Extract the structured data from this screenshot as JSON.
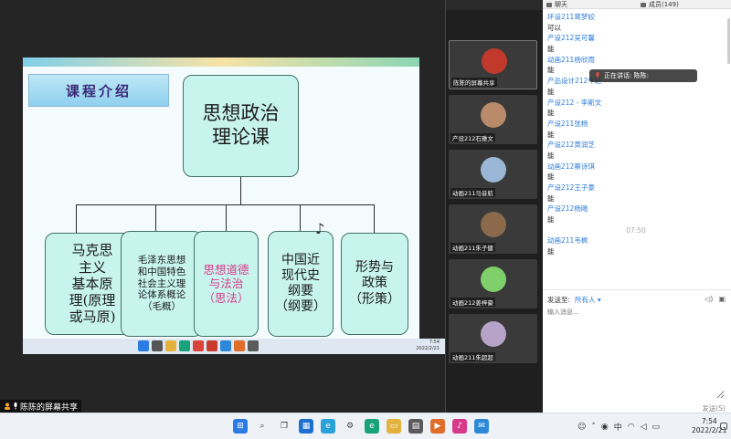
{
  "slide": {
    "title": "课程介绍",
    "root": "思想政治\n理论课",
    "children": [
      "马克思\n主义\n基本原\n理(原理\n或马原)",
      "毛泽东思想\n和中国特色\n社会主义理\n论体系概论\n（毛概）",
      "思想道德\n与法治\n（思法）",
      "中国近\n现代史\n纲要\n（纲要）",
      "形势与\n政策\n（形策）"
    ]
  },
  "mini_taskbar": {
    "time": "7:54",
    "date": "2022/2/21"
  },
  "share_label": "陈陈的屏幕共享",
  "video_tiles": [
    {
      "name": "陈陈的屏幕共享",
      "color": "#c0392b"
    },
    {
      "name": "产设212石雅文",
      "color": "#b98b6a"
    },
    {
      "name": "动画211马音航",
      "color": "#9bb7d6"
    },
    {
      "name": "动画211朱子健",
      "color": "#8a6a4a"
    },
    {
      "name": "动画212姜梓豪",
      "color": "#7fcf6a"
    },
    {
      "name": "动画211朱超超",
      "color": "#b7a3c7"
    }
  ],
  "chat": {
    "tab_chat": "聊天",
    "tab_members": "成员(149)",
    "messages": [
      {
        "kind": "sender",
        "text": "环设211蒋梦姣"
      },
      {
        "kind": "text",
        "text": "可以"
      },
      {
        "kind": "sender",
        "text": "产设212吴可馨"
      },
      {
        "kind": "text",
        "text": "能"
      },
      {
        "kind": "sender",
        "text": "动画211杨欣雨"
      },
      {
        "kind": "text",
        "text": "能"
      },
      {
        "kind": "sender",
        "text": "产品设计212牛廷"
      },
      {
        "kind": "text",
        "text": "能"
      },
      {
        "kind": "sender",
        "text": "产设212 - 李斯文"
      },
      {
        "kind": "text",
        "text": "能"
      },
      {
        "kind": "sender",
        "text": "产设211张杨"
      },
      {
        "kind": "text",
        "text": "能"
      },
      {
        "kind": "sender",
        "text": "产设212黄润芝"
      },
      {
        "kind": "text",
        "text": "能"
      },
      {
        "kind": "sender",
        "text": "动画212蔡诗琪"
      },
      {
        "kind": "text",
        "text": "能"
      },
      {
        "kind": "sender",
        "text": "产设212王子豪"
      },
      {
        "kind": "text",
        "text": "能"
      },
      {
        "kind": "sender",
        "text": "产设212杨飏"
      },
      {
        "kind": "text",
        "text": "能"
      },
      {
        "kind": "time",
        "text": "07:50"
      },
      {
        "kind": "sender",
        "text": "动画211韦枫"
      },
      {
        "kind": "text",
        "text": "能"
      }
    ],
    "speaking": "正在讲话: 陈陈:",
    "send_to_label": "发送至:",
    "send_target": "所有人",
    "input_placeholder": "输入消息...",
    "send_button": "发送(S)"
  },
  "taskbar": {
    "tray_lang": "中",
    "time": "7:54",
    "date": "2022/2/21"
  }
}
